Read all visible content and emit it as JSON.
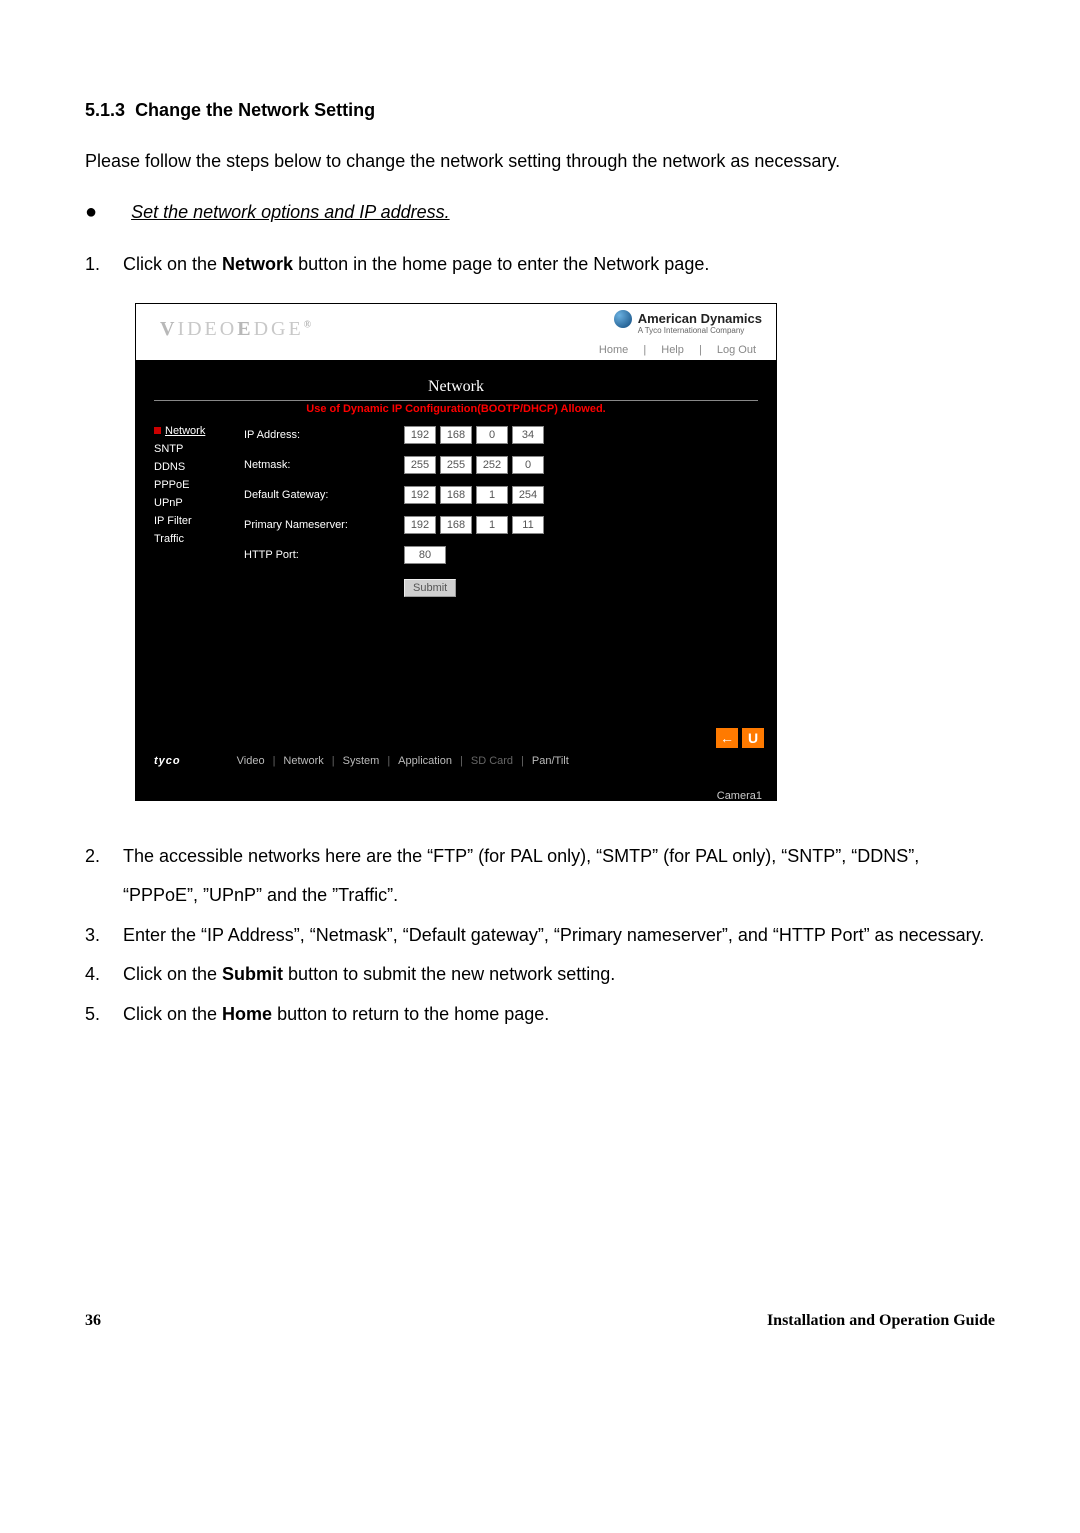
{
  "doc": {
    "section_number": "5.1.3",
    "heading": "Change the Network Setting",
    "intro": "Please follow the steps below to change the network setting through the network as necessary.",
    "bullet": "Set the network options and IP address.",
    "steps": {
      "s1_pre": "Click on the ",
      "s1_bold": "Network",
      "s1_post": " button in the home page to enter the Network page.",
      "s2": "The accessible networks here are the “FTP” (for PAL only), “SMTP” (for PAL only), “SNTP”, “DDNS”, “PPPoE”, ”UPnP” and the ”Traffic”.",
      "s3": "Enter the “IP Address”, “Netmask”, “Default gateway”, “Primary nameserver”, and “HTTP Port” as necessary.",
      "s4_pre": "Click on the ",
      "s4_bold": "Submit",
      "s4_post": " button to submit the new network setting.",
      "s5_pre": "Click on the ",
      "s5_bold": "Home",
      "s5_post": " button to return to the home page."
    },
    "page_num": "36",
    "footer_title": "Installation and Operation Guide"
  },
  "ui": {
    "logo": "VIDEOEDGE",
    "brand": "American Dynamics",
    "brand_sub": "A Tyco International Company",
    "top_links": [
      "Home",
      "Help",
      "Log Out"
    ],
    "title": "Network",
    "warning": "Use of Dynamic IP Configuration(BOOTP/DHCP) Allowed.",
    "sidebar": [
      "Network",
      "SNTP",
      "DDNS",
      "PPPoE",
      "UPnP",
      "IP Filter",
      "Traffic"
    ],
    "form": {
      "ip_label": "IP Address:",
      "ip": [
        "192",
        "168",
        "0",
        "34"
      ],
      "mask_label": "Netmask:",
      "mask": [
        "255",
        "255",
        "252",
        "0"
      ],
      "gw_label": "Default Gateway:",
      "gw": [
        "192",
        "168",
        "1",
        "254"
      ],
      "dns_label": "Primary Nameserver:",
      "dns": [
        "192",
        "168",
        "1",
        "11"
      ],
      "port_label": "HTTP Port:",
      "port": "80",
      "submit": "Submit"
    },
    "bottom_tabs": [
      "Video",
      "Network",
      "System",
      "Application",
      "SD Card",
      "Pan/Tilt"
    ],
    "brand_bl": "tyco",
    "camera": "Camera1",
    "orange_back": "←",
    "orange_u": "U"
  }
}
